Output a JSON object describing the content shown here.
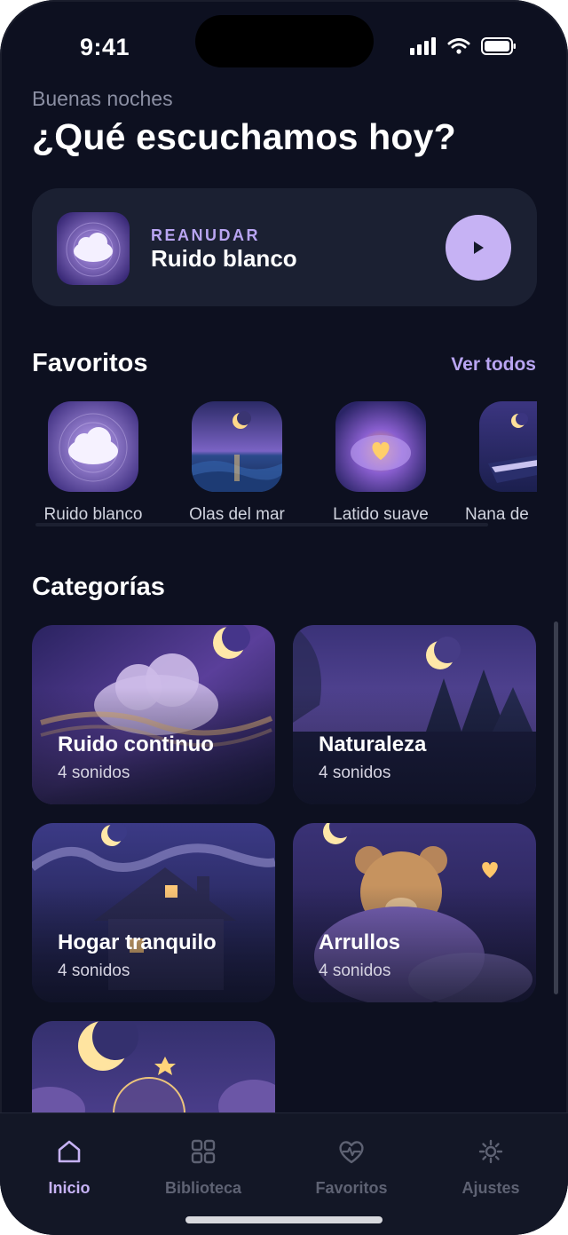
{
  "status_bar": {
    "time": "9:41"
  },
  "header": {
    "greeting": "Buenas noches",
    "headline": "¿Qué escuchamos hoy?"
  },
  "resume": {
    "kicker": "REANUDAR",
    "title": "Ruido blanco",
    "play_icon": "play-icon"
  },
  "favorites": {
    "title": "Favoritos",
    "see_all": "Ver todos",
    "items": [
      {
        "label": "Ruido blanco"
      },
      {
        "label": "Olas del mar"
      },
      {
        "label": "Latido suave"
      },
      {
        "label": "Nana de"
      }
    ]
  },
  "categories": {
    "title": "Categorías",
    "items": [
      {
        "title": "Ruido continuo",
        "count": "4 sonidos"
      },
      {
        "title": "Naturaleza",
        "count": "4 sonidos"
      },
      {
        "title": "Hogar tranquilo",
        "count": "4 sonidos"
      },
      {
        "title": "Arrullos",
        "count": "4 sonidos"
      }
    ]
  },
  "tabbar": {
    "items": [
      {
        "label": "Inicio",
        "icon": "home-icon",
        "active": true
      },
      {
        "label": "Biblioteca",
        "icon": "grid-icon",
        "active": false
      },
      {
        "label": "Favoritos",
        "icon": "heart-pulse-icon",
        "active": false
      },
      {
        "label": "Ajustes",
        "icon": "settings-icon",
        "active": false
      }
    ]
  },
  "colors": {
    "background": "#0d1020",
    "card": "#1b2032",
    "accent": "#c6b2f4",
    "accent_text": "#b9a5f2",
    "tab_inactive": "#5e6273"
  }
}
